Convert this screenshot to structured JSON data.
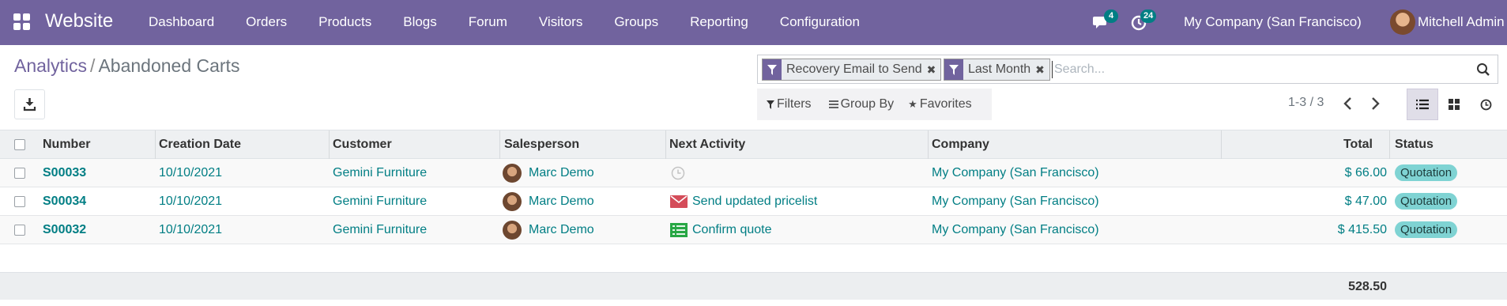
{
  "navbar": {
    "brand": "Website",
    "menu": [
      "Dashboard",
      "Orders",
      "Products",
      "Blogs",
      "Forum",
      "Visitors",
      "Groups",
      "Reporting",
      "Configuration"
    ],
    "messages_count": "4",
    "activities_count": "24",
    "company": "My Company (San Francisco)",
    "user": "Mitchell Admin",
    "color": "#71639e"
  },
  "breadcrumb": {
    "parent": "Analytics",
    "separator": "/",
    "current": "Abandoned Carts"
  },
  "search": {
    "facets": [
      "Recovery Email to Send",
      "Last Month"
    ],
    "placeholder": "Search..."
  },
  "filters": {
    "filters_label": "Filters",
    "groupby_label": "Group By",
    "favorites_label": "Favorites"
  },
  "pager": {
    "text": "1-3 / 3"
  },
  "table": {
    "columns": [
      "Number",
      "Creation Date",
      "Customer",
      "Salesperson",
      "Next Activity",
      "Company",
      "Total",
      "Status"
    ],
    "rows": [
      {
        "number": "S00033",
        "date": "10/10/2021",
        "customer": "Gemini Furniture",
        "salesperson": "Marc Demo",
        "activity": "",
        "activity_icon": "clock-icon",
        "company": "My Company (San Francisco)",
        "total": "$ 66.00",
        "status": "Quotation"
      },
      {
        "number": "S00034",
        "date": "10/10/2021",
        "customer": "Gemini Furniture",
        "salesperson": "Marc Demo",
        "activity": "Send updated pricelist",
        "activity_icon": "envelope-icon",
        "company": "My Company (San Francisco)",
        "total": "$ 47.00",
        "status": "Quotation"
      },
      {
        "number": "S00032",
        "date": "10/10/2021",
        "customer": "Gemini Furniture",
        "salesperson": "Marc Demo",
        "activity": "Confirm quote",
        "activity_icon": "list-check-icon",
        "company": "My Company (San Francisco)",
        "total": "$ 415.50",
        "status": "Quotation"
      }
    ],
    "grand_total": "528.50"
  },
  "colors": {
    "link": "#017e84",
    "status_badge": "#7fd3d3",
    "activity_mail": "#d44c59",
    "activity_todo": "#28a745"
  }
}
